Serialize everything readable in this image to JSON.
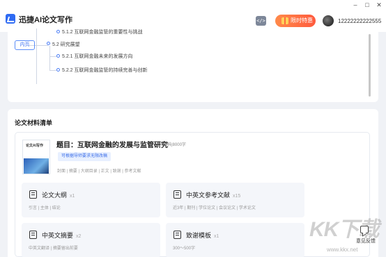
{
  "app": {
    "title": "迅捷AI论文写作",
    "code_icon": "code-icon",
    "promo_label": "限时特惠",
    "user_name": "12222222222555",
    "window_controls": [
      "–",
      "□",
      "✕"
    ]
  },
  "outline": {
    "tag_label": "内页",
    "items": [
      {
        "text": "5.1.2 互联网金融监管的重要性与挑战"
      },
      {
        "text": "5.2 研究展望"
      },
      {
        "text": "5.2.1 互联网金融未来的发展方向"
      },
      {
        "text": "5.2.2 互联网金融监管的持续完善与创新"
      }
    ]
  },
  "materials": {
    "section_title": "论文材料清单",
    "cover_title": "论文AI写作",
    "paper_title": "题目：互联网金融的发展与监管研究",
    "paper_meta": "专科|8000字",
    "edit_tag": "可根据导师要求无限改稿",
    "contents": "封面 | 摘要 | 大纲目录 | 正文 | 致谢 | 参考文献",
    "items": [
      {
        "name": "论文大纲",
        "count": "x1",
        "desc": "引言 | 主体 | 结论",
        "icon": "outline-icon"
      },
      {
        "name": "中英文参考文献",
        "count": "x15",
        "desc": "近3年 | 期刊 | 学位论文 | 会议论文 | 学术论文",
        "icon": "reference-icon"
      },
      {
        "name": "中英文摘要",
        "count": "x2",
        "desc": "中英文翻译 | 摘要留出前要",
        "icon": "abstract-icon"
      },
      {
        "name": "致谢模板",
        "count": "x1",
        "desc": "300～500字",
        "icon": "thanks-icon"
      }
    ]
  },
  "feedback": {
    "label": "意见反馈",
    "icon": "feedback-icon"
  },
  "watermark": {
    "big": "KK下载",
    "small": "www.kkx.net"
  },
  "colors": {
    "accent": "#2f6bf3",
    "promo": "#ff6a3d",
    "panel_bg": "#f4f6fa"
  }
}
